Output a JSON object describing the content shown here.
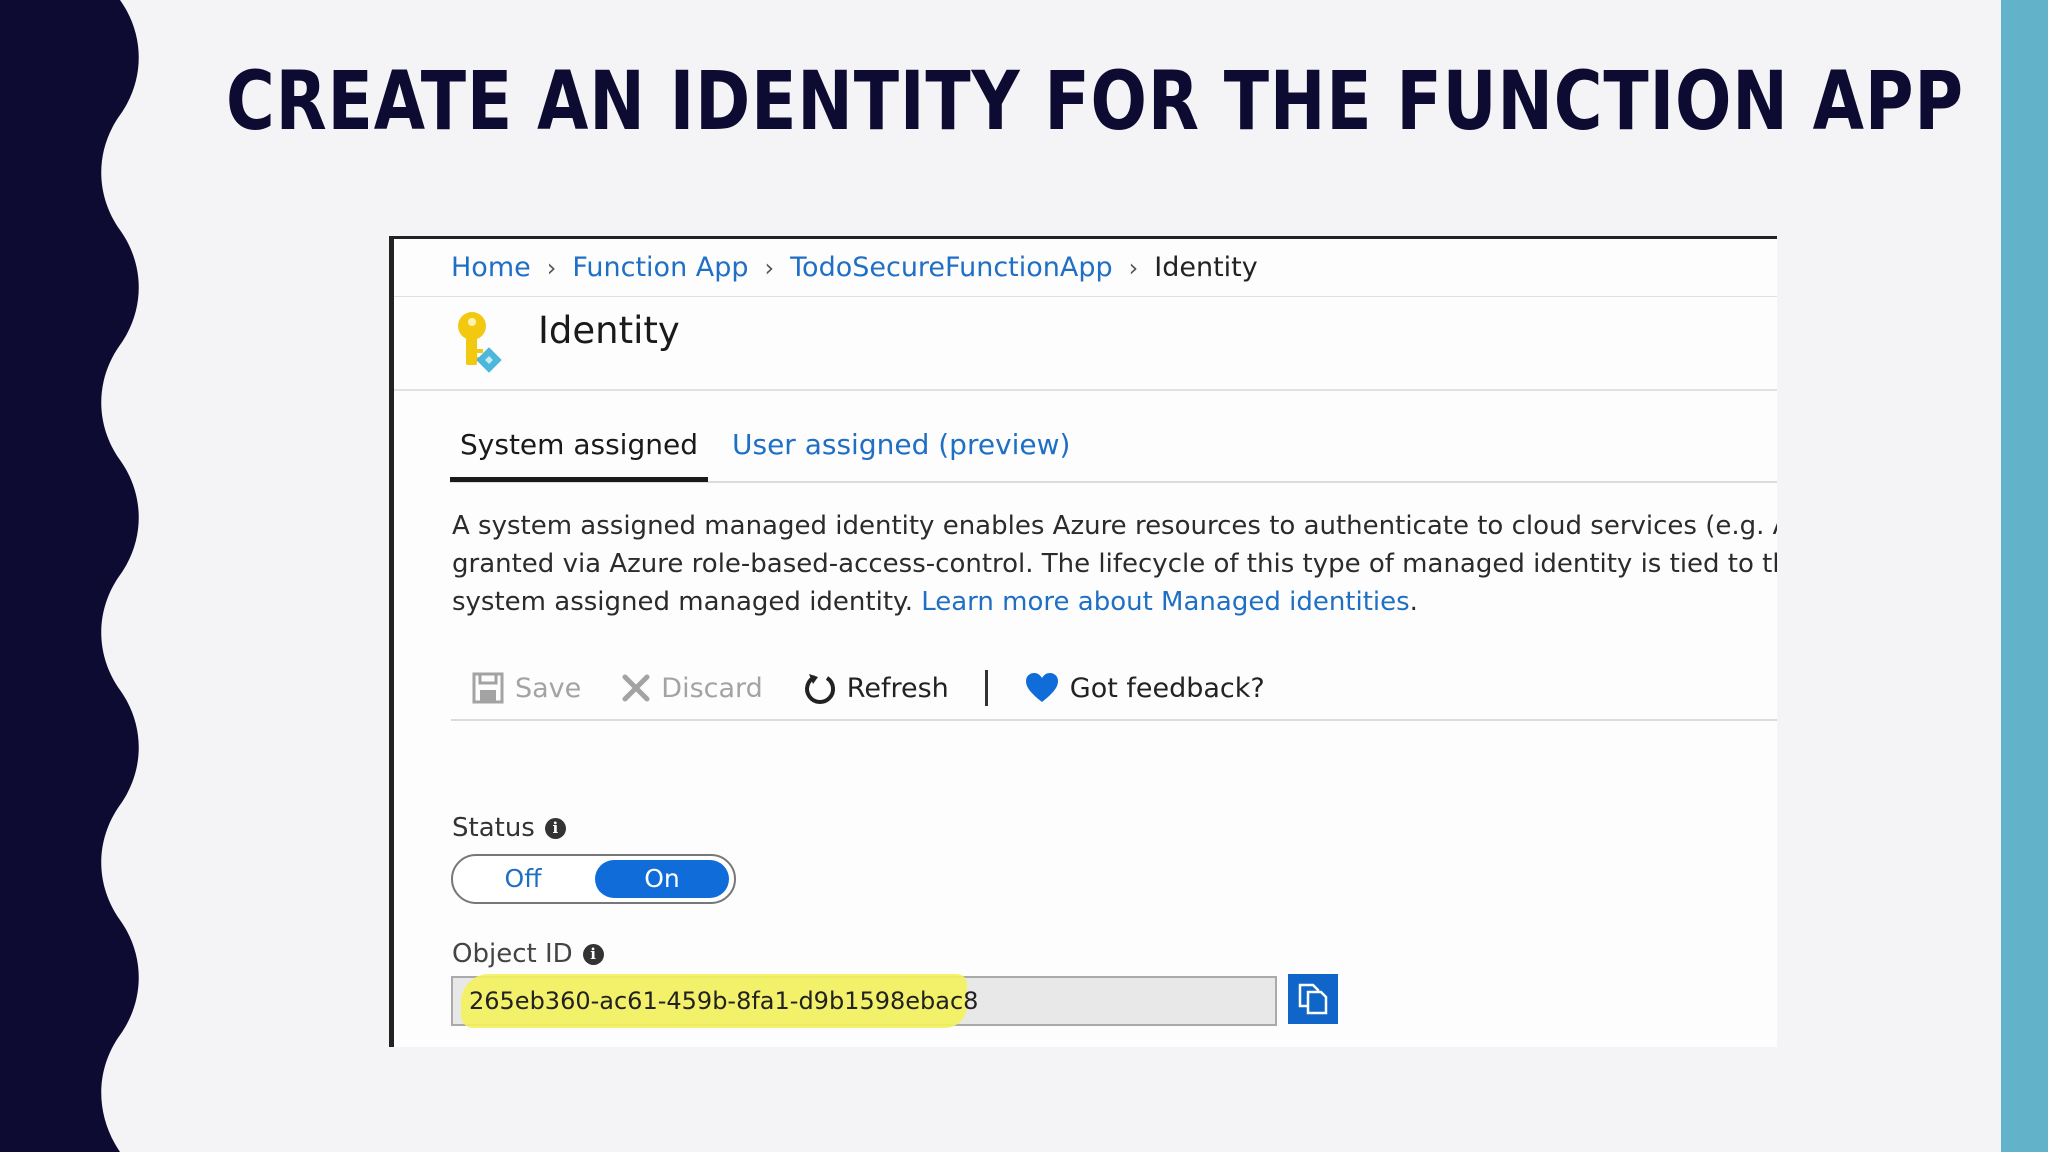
{
  "slide": {
    "title": "CREATE AN IDENTITY FOR THE FUNCTION APP",
    "colors": {
      "title": "#0e0b33",
      "left_wave": "#0e0b33",
      "right_bar": "#62b3c9",
      "background": "#f4f4f6"
    }
  },
  "screenshot": {
    "breadcrumb": {
      "items": [
        "Home",
        "Function App",
        "TodoSecureFunctionApp"
      ],
      "current": "Identity",
      "separator": ">"
    },
    "header": {
      "title": "Identity",
      "icon": "key-identity-icon"
    },
    "tabs": [
      {
        "label": "System assigned",
        "active": true
      },
      {
        "label": "User assigned (preview)",
        "active": false
      }
    ],
    "description": {
      "line1": "A system assigned managed identity enables Azure resources to authenticate to cloud services (e.g. Azure I",
      "line2": "granted via Azure role-based-access-control. The lifecycle of this type of managed identity is tied to the life",
      "line3_text": "system assigned managed identity. ",
      "link": "Learn more about Managed identities",
      "line3_end": "."
    },
    "toolbar": {
      "save": "Save",
      "discard": "Discard",
      "refresh": "Refresh",
      "feedback": "Got feedback?"
    },
    "status": {
      "label": "Status",
      "off_label": "Off",
      "on_label": "On",
      "selected": "On"
    },
    "object_id": {
      "label": "Object ID",
      "value": "265eb360-ac61-459b-8fa1-d9b1598ebac8"
    },
    "colors": {
      "link": "#1f6fc5",
      "toggle_on": "#0f6cd8",
      "highlight": "#f3f25b",
      "copy_button": "#1065c8"
    }
  }
}
